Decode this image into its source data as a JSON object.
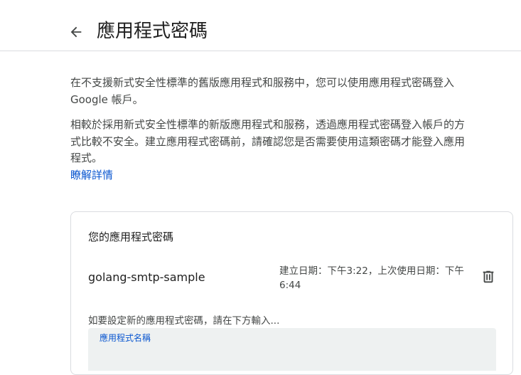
{
  "header": {
    "title": "應用程式密碼",
    "back_icon": "arrow-back-icon"
  },
  "intro": {
    "paragraph1": "在不支援新式安全性標準的舊版應用程式和服務中，您可以使用應用程式密碼登入 Google 帳戶。",
    "paragraph2": "相較於採用新式安全性標準的新版應用程式和服務，透過應用程式密碼登入帳戶的方式比較不安全。建立應用程式密碼前，請確認您是否需要使用這類密碼才能登入應用程式。",
    "learn_more": "瞭解詳情"
  },
  "card": {
    "title": "您的應用程式密碼",
    "passwords": [
      {
        "name": "golang-smtp-sample",
        "dates": "建立日期：下午3:22，上次使用日期：下午 6:44",
        "delete_icon": "trash-icon"
      }
    ],
    "hint": "如要設定新的應用程式密碼，請在下方輸入...",
    "input": {
      "label": "應用程式名稱",
      "value": ""
    }
  },
  "colors": {
    "accent": "#0b57d0",
    "text": "#1f1f1f",
    "secondary_text": "#444746",
    "divider": "#dadce0",
    "input_bg": "#eef1f1"
  }
}
